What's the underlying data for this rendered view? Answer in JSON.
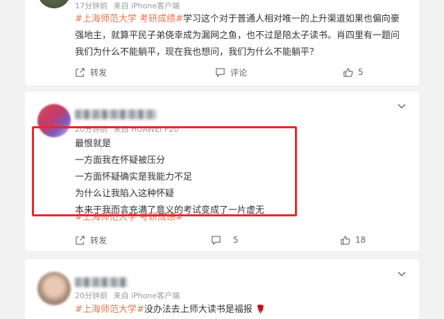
{
  "posts": [
    {
      "time": "17分钟前",
      "source": "",
      "tag": "#上海师范大学 考研成绩#",
      "body": "学习这个对于普通人相对唯一的上升渠道如果也偏向豪强地主，就算平民子弟侥幸成为漏网之鱼，也不过是陪太子读书。肖四里有一题问我们为什么不能躺平，现在我也想问，我们为什么不能躺平？",
      "repost_label": "转发",
      "comment_label": "评论",
      "like_count": "5"
    },
    {
      "time": "20分钟前",
      "source": "来自 HUAWEI P20",
      "lines": [
        "最恨就是",
        "一方面我在怀疑被压分",
        "一方面怀疑确实是我能力不足",
        "为什么让我陷入这种怀疑",
        "本来于我而言充满了意义的考试变成了一片虚无"
      ],
      "tag": "#上海师范大学 考研成绩#",
      "repost_label": "转发",
      "comment_count": "5",
      "like_count": "18"
    },
    {
      "time": "20分钟前",
      "source": "来自 iPhone客户端",
      "tag": "#上海师范大学#",
      "body": "没办法去上师大读书是福报",
      "emoji": "🌹"
    }
  ],
  "post1_source": "来自 iPhone客户端",
  "colors": {
    "tag": "#eb7350",
    "highlight_box": "#e8272c",
    "page_bg": "#f2f2f2"
  },
  "icons": [
    "repost-icon",
    "comment-icon",
    "like-icon",
    "chevron-down-icon",
    "rose-emoji"
  ]
}
